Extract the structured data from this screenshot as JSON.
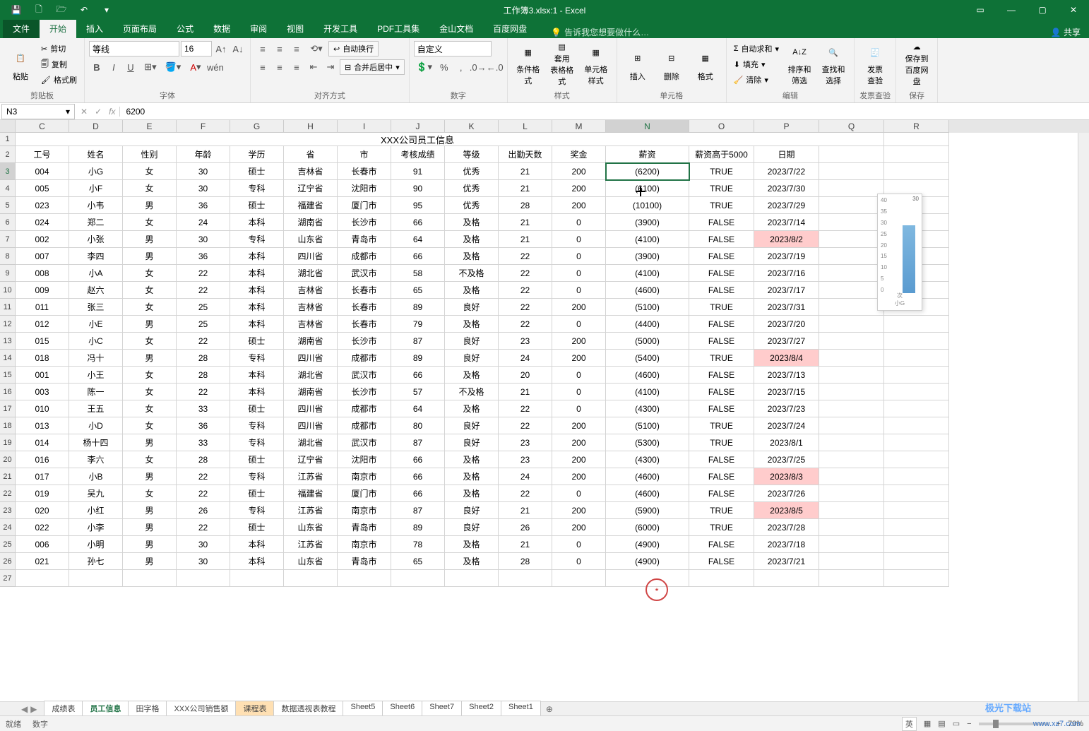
{
  "title_bar": {
    "title": "工作簿3.xlsx:1 - Excel"
  },
  "ribbon_tabs": {
    "file": "文件",
    "home": "开始",
    "insert": "插入",
    "layout": "页面布局",
    "formulas": "公式",
    "data": "数据",
    "review": "审阅",
    "view": "视图",
    "dev": "开发工具",
    "pdf": "PDF工具集",
    "jinshan": "金山文档",
    "baidu": "百度网盘",
    "tell_me": "告诉我您想要做什么…",
    "share": "共享"
  },
  "ribbon": {
    "clipboard": {
      "paste": "粘贴",
      "cut": "剪切",
      "copy": "复制",
      "painter": "格式刷",
      "label": "剪贴板"
    },
    "font": {
      "name": "等线",
      "size": "16",
      "label": "字体"
    },
    "align": {
      "wrap": "自动换行",
      "merge": "合并后居中",
      "label": "对齐方式"
    },
    "number": {
      "format": "自定义",
      "label": "数字"
    },
    "styles": {
      "cond": "条件格式",
      "table": "套用\n表格格式",
      "cell": "单元格样式",
      "label": "样式"
    },
    "cells": {
      "insert": "插入",
      "delete": "删除",
      "format": "格式",
      "label": "单元格"
    },
    "editing": {
      "sum": "自动求和",
      "fill": "填充",
      "clear": "清除",
      "sort": "排序和筛选",
      "find": "查找和选择",
      "label": "编辑"
    },
    "invoice": {
      "check": "发票\n查验",
      "label": "发票查验"
    },
    "baidu": {
      "save": "保存到\n百度网盘",
      "label": "保存"
    }
  },
  "name_box": "N3",
  "formula": "6200",
  "columns": [
    "C",
    "D",
    "E",
    "F",
    "G",
    "H",
    "I",
    "J",
    "K",
    "L",
    "M",
    "N",
    "O",
    "P",
    "Q",
    "R"
  ],
  "merged_title": "XXX公司员工信息",
  "headers": [
    "工号",
    "姓名",
    "性别",
    "年龄",
    "学历",
    "省",
    "市",
    "考核成绩",
    "等级",
    "出勤天数",
    "奖金",
    "薪资",
    "薪资高于5000",
    "日期"
  ],
  "rows": [
    {
      "n": 3,
      "d": [
        "004",
        "小G",
        "女",
        "30",
        "硕士",
        "吉林省",
        "长春市",
        "91",
        "优秀",
        "21",
        "200",
        "(6200)",
        "TRUE",
        "2023/7/22"
      ]
    },
    {
      "n": 4,
      "d": [
        "005",
        "小F",
        "女",
        "30",
        "专科",
        "辽宁省",
        "沈阳市",
        "90",
        "优秀",
        "21",
        "200",
        "(6100)",
        "TRUE",
        "2023/7/30"
      ]
    },
    {
      "n": 5,
      "d": [
        "023",
        "小韦",
        "男",
        "36",
        "硕士",
        "福建省",
        "厦门市",
        "95",
        "优秀",
        "28",
        "200",
        "(10100)",
        "TRUE",
        "2023/7/29"
      ]
    },
    {
      "n": 6,
      "d": [
        "024",
        "郑二",
        "女",
        "24",
        "本科",
        "湖南省",
        "长沙市",
        "66",
        "及格",
        "21",
        "0",
        "(3900)",
        "FALSE",
        "2023/7/14"
      ]
    },
    {
      "n": 7,
      "d": [
        "002",
        "小张",
        "男",
        "30",
        "专科",
        "山东省",
        "青岛市",
        "64",
        "及格",
        "21",
        "0",
        "(4100)",
        "FALSE",
        "2023/8/2"
      ],
      "hl": [
        13
      ]
    },
    {
      "n": 8,
      "d": [
        "007",
        "李四",
        "男",
        "36",
        "本科",
        "四川省",
        "成都市",
        "66",
        "及格",
        "22",
        "0",
        "(3900)",
        "FALSE",
        "2023/7/19"
      ]
    },
    {
      "n": 9,
      "d": [
        "008",
        "小A",
        "女",
        "22",
        "本科",
        "湖北省",
        "武汉市",
        "58",
        "不及格",
        "22",
        "0",
        "(4100)",
        "FALSE",
        "2023/7/16"
      ]
    },
    {
      "n": 10,
      "d": [
        "009",
        "赵六",
        "女",
        "22",
        "本科",
        "吉林省",
        "长春市",
        "65",
        "及格",
        "22",
        "0",
        "(4600)",
        "FALSE",
        "2023/7/17"
      ]
    },
    {
      "n": 11,
      "d": [
        "011",
        "张三",
        "女",
        "25",
        "本科",
        "吉林省",
        "长春市",
        "89",
        "良好",
        "22",
        "200",
        "(5100)",
        "TRUE",
        "2023/7/31"
      ]
    },
    {
      "n": 12,
      "d": [
        "012",
        "小E",
        "男",
        "25",
        "本科",
        "吉林省",
        "长春市",
        "79",
        "及格",
        "22",
        "0",
        "(4400)",
        "FALSE",
        "2023/7/20"
      ]
    },
    {
      "n": 13,
      "d": [
        "015",
        "小C",
        "女",
        "22",
        "硕士",
        "湖南省",
        "长沙市",
        "87",
        "良好",
        "23",
        "200",
        "(5000)",
        "FALSE",
        "2023/7/27"
      ]
    },
    {
      "n": 14,
      "d": [
        "018",
        "冯十",
        "男",
        "28",
        "专科",
        "四川省",
        "成都市",
        "89",
        "良好",
        "24",
        "200",
        "(5400)",
        "TRUE",
        "2023/8/4"
      ],
      "hl": [
        13
      ]
    },
    {
      "n": 15,
      "d": [
        "001",
        "小王",
        "女",
        "28",
        "本科",
        "湖北省",
        "武汉市",
        "66",
        "及格",
        "20",
        "0",
        "(4600)",
        "FALSE",
        "2023/7/13"
      ]
    },
    {
      "n": 16,
      "d": [
        "003",
        "陈一",
        "女",
        "22",
        "本科",
        "湖南省",
        "长沙市",
        "57",
        "不及格",
        "21",
        "0",
        "(4100)",
        "FALSE",
        "2023/7/15"
      ]
    },
    {
      "n": 17,
      "d": [
        "010",
        "王五",
        "女",
        "33",
        "硕士",
        "四川省",
        "成都市",
        "64",
        "及格",
        "22",
        "0",
        "(4300)",
        "FALSE",
        "2023/7/23"
      ]
    },
    {
      "n": 18,
      "d": [
        "013",
        "小D",
        "女",
        "36",
        "专科",
        "四川省",
        "成都市",
        "80",
        "良好",
        "22",
        "200",
        "(5100)",
        "TRUE",
        "2023/7/24"
      ]
    },
    {
      "n": 19,
      "d": [
        "014",
        "杨十四",
        "男",
        "33",
        "专科",
        "湖北省",
        "武汉市",
        "87",
        "良好",
        "23",
        "200",
        "(5300)",
        "TRUE",
        "2023/8/1"
      ]
    },
    {
      "n": 20,
      "d": [
        "016",
        "李六",
        "女",
        "28",
        "硕士",
        "辽宁省",
        "沈阳市",
        "66",
        "及格",
        "23",
        "200",
        "(4300)",
        "FALSE",
        "2023/7/25"
      ]
    },
    {
      "n": 21,
      "d": [
        "017",
        "小B",
        "男",
        "22",
        "专科",
        "江苏省",
        "南京市",
        "66",
        "及格",
        "24",
        "200",
        "(4600)",
        "FALSE",
        "2023/8/3"
      ],
      "hl": [
        13
      ]
    },
    {
      "n": 22,
      "d": [
        "019",
        "吴九",
        "女",
        "22",
        "硕士",
        "福建省",
        "厦门市",
        "66",
        "及格",
        "22",
        "0",
        "(4600)",
        "FALSE",
        "2023/7/26"
      ]
    },
    {
      "n": 23,
      "d": [
        "020",
        "小红",
        "男",
        "26",
        "专科",
        "江苏省",
        "南京市",
        "87",
        "良好",
        "21",
        "200",
        "(5900)",
        "TRUE",
        "2023/8/5"
      ],
      "hl": [
        13
      ]
    },
    {
      "n": 24,
      "d": [
        "022",
        "小李",
        "男",
        "22",
        "硕士",
        "山东省",
        "青岛市",
        "89",
        "良好",
        "26",
        "200",
        "(6000)",
        "TRUE",
        "2023/7/28"
      ]
    },
    {
      "n": 25,
      "d": [
        "006",
        "小明",
        "男",
        "30",
        "本科",
        "江苏省",
        "南京市",
        "78",
        "及格",
        "21",
        "0",
        "(4900)",
        "FALSE",
        "2023/7/18"
      ]
    },
    {
      "n": 26,
      "d": [
        "021",
        "孙七",
        "男",
        "30",
        "本科",
        "山东省",
        "青岛市",
        "65",
        "及格",
        "28",
        "0",
        "(4900)",
        "FALSE",
        "2023/7/21"
      ]
    }
  ],
  "empty_rows": [
    27
  ],
  "sheet_tabs": {
    "tabs": [
      "成绩表",
      "员工信息",
      "田字格",
      "XXX公司销售额",
      "课程表",
      "数据透视表教程",
      "Sheet5",
      "Sheet6",
      "Sheet7",
      "Sheet2",
      "Sheet1"
    ],
    "active": 1,
    "colored": [
      4
    ]
  },
  "status": {
    "ready": "就绪",
    "numlock": "数字",
    "zoom": "70%"
  },
  "chart_data": {
    "type": "bar",
    "categories": [
      "小G"
    ],
    "values": [
      30
    ],
    "ylabel": "",
    "ylim": [
      0,
      40
    ],
    "yticks": [
      0,
      5,
      10,
      15,
      20,
      25,
      30,
      35,
      40
    ],
    "xlabel": "小G",
    "series_label": "次"
  },
  "watermark1": "www.xz7.com",
  "watermark2": "极光下载站",
  "input_method": "英"
}
